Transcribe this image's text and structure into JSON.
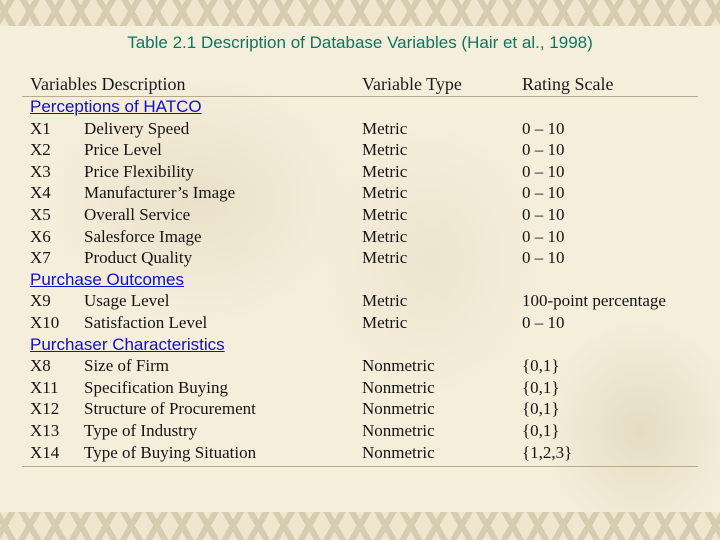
{
  "title": "Table 2.1  Description of Database Variables (Hair et al., 1998)",
  "headers": {
    "description": "Variables Description",
    "type": "Variable Type",
    "scale": "Rating Scale"
  },
  "sections": [
    {
      "label": "Perceptions of HATCO",
      "rows": [
        {
          "id": "X1",
          "desc": "Delivery Speed",
          "type": "Metric",
          "scale": "0 – 10"
        },
        {
          "id": "X2",
          "desc": "Price Level",
          "type": "Metric",
          "scale": "0 – 10"
        },
        {
          "id": "X3",
          "desc": "Price Flexibility",
          "type": "Metric",
          "scale": "0 – 10"
        },
        {
          "id": "X4",
          "desc": "Manufacturer’s Image",
          "type": "Metric",
          "scale": "0 – 10"
        },
        {
          "id": "X5",
          "desc": "Overall Service",
          "type": "Metric",
          "scale": "0 – 10"
        },
        {
          "id": "X6",
          "desc": "Salesforce Image",
          "type": "Metric",
          "scale": "0 – 10"
        },
        {
          "id": "X7",
          "desc": "Product Quality",
          "type": "Metric",
          "scale": "0 – 10"
        }
      ]
    },
    {
      "label": "Purchase Outcomes",
      "rows": [
        {
          "id": "X9",
          "desc": "Usage Level",
          "type": "Metric",
          "scale": "100-point percentage"
        },
        {
          "id": "X10",
          "desc": "Satisfaction Level",
          "type": "Metric",
          "scale": "0 – 10"
        }
      ]
    },
    {
      "label": "Purchaser Characteristics",
      "rows": [
        {
          "id": "X8",
          "desc": "Size of Firm",
          "type": "Nonmetric",
          "scale": "{0,1}"
        },
        {
          "id": "X11",
          "desc": "Specification Buying",
          "type": "Nonmetric",
          "scale": "{0,1}"
        },
        {
          "id": "X12",
          "desc": "Structure of Procurement",
          "type": "Nonmetric",
          "scale": "{0,1}"
        },
        {
          "id": "X13",
          "desc": "Type of Industry",
          "type": "Nonmetric",
          "scale": "{0,1}"
        },
        {
          "id": "X14",
          "desc": "Type of Buying Situation",
          "type": "Nonmetric",
          "scale": "{1,2,3}"
        }
      ]
    }
  ],
  "colors": {
    "title": "#0f7462",
    "section_link": "#1010c8",
    "background": "#f5eedb"
  }
}
